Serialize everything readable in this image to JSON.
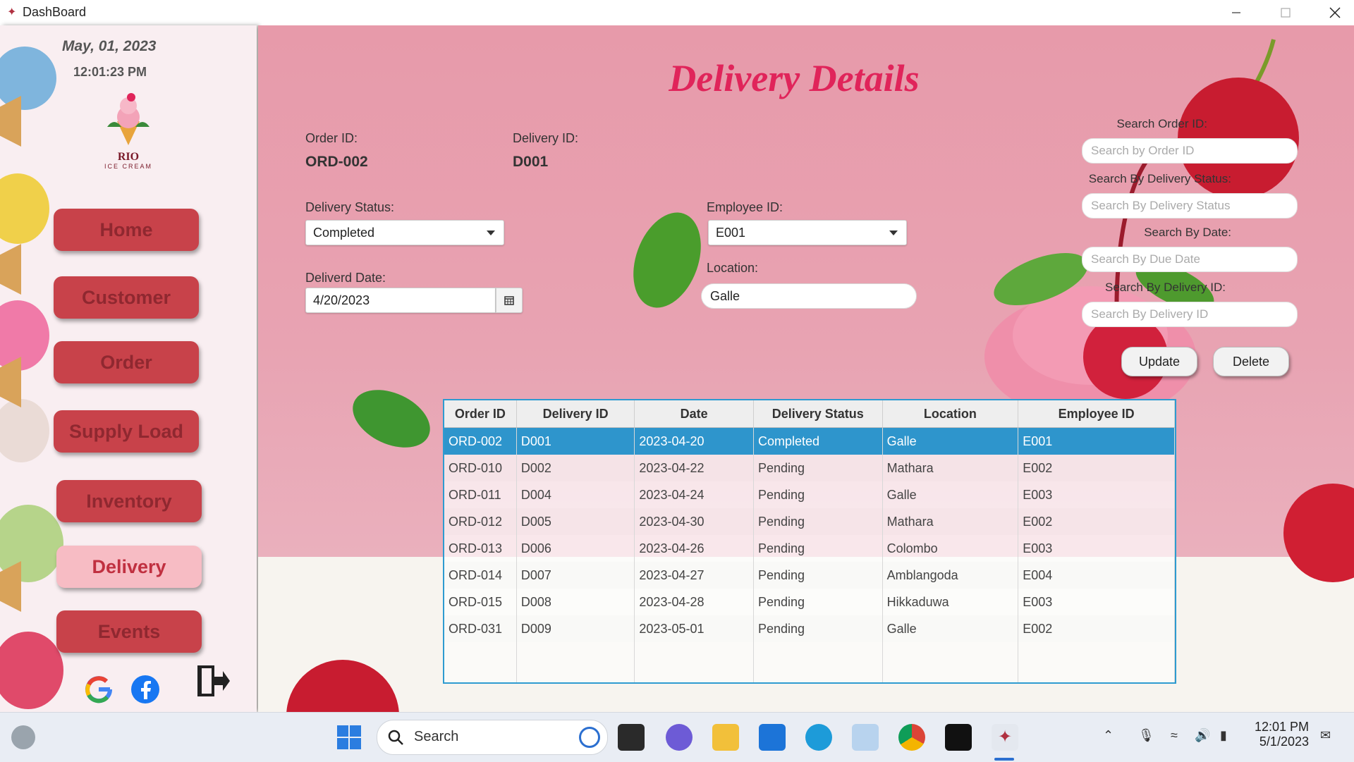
{
  "window": {
    "title": "DashBoard"
  },
  "sidebar": {
    "date": "May,  01, 2023",
    "time": "12:01:23 PM",
    "logo": {
      "name": "RIO",
      "tagline": "ICE CREAM"
    },
    "nav": [
      {
        "label": "Home",
        "active": false
      },
      {
        "label": "Customer",
        "active": false
      },
      {
        "label": "Order",
        "active": false
      },
      {
        "label": "Supply Load",
        "active": false
      },
      {
        "label": "Inventory",
        "active": false
      },
      {
        "label": "Delivery",
        "active": true
      },
      {
        "label": "Events",
        "active": false
      }
    ],
    "social": [
      "google-icon",
      "facebook-icon",
      "logout-icon"
    ]
  },
  "main": {
    "title": "Delivery Details",
    "order_id": {
      "label": "Order ID:",
      "value": "ORD-002"
    },
    "delivery_id": {
      "label": "Delivery ID:",
      "value": "D001"
    },
    "delivery_status": {
      "label": "Delivery Status:",
      "value": "Completed"
    },
    "delivered_date": {
      "label": "Deliverd Date:",
      "value": "4/20/2023"
    },
    "employee_id": {
      "label": "Employee ID:",
      "value": "E001"
    },
    "location": {
      "label": "Location:",
      "value": "Galle"
    },
    "search": {
      "order_id": {
        "label": "Search Order ID:",
        "placeholder": "Search by Order ID"
      },
      "delivery_status": {
        "label": "Search By Delivery Status:",
        "placeholder": "Search By Delivery Status"
      },
      "date": {
        "label": "Search By Date:",
        "placeholder": "Search By Due Date"
      },
      "delivery_id": {
        "label": "Search By Delivery ID:",
        "placeholder": "Search By Delivery ID"
      }
    },
    "buttons": {
      "update": "Update",
      "delete": "Delete"
    },
    "table": {
      "columns": [
        "Order ID",
        "Delivery ID",
        "Date",
        "Delivery Status",
        "Location",
        "Employee ID"
      ],
      "rows": [
        [
          "ORD-002",
          "D001",
          "2023-04-20",
          "Completed",
          "Galle",
          "E001"
        ],
        [
          "ORD-010",
          "D002",
          "2023-04-22",
          "Pending",
          "Mathara",
          "E002"
        ],
        [
          "ORD-011",
          "D004",
          "2023-04-24",
          "Pending",
          "Galle",
          "E003"
        ],
        [
          "ORD-012",
          "D005",
          "2023-04-30",
          "Pending",
          "Mathara",
          "E002"
        ],
        [
          "ORD-013",
          "D006",
          "2023-04-26",
          "Pending",
          "Colombo",
          "E003"
        ],
        [
          "ORD-014",
          "D007",
          "2023-04-27",
          "Pending",
          "Amblangoda",
          "E004"
        ],
        [
          "ORD-015",
          "D008",
          "2023-04-28",
          "Pending",
          "Hikkaduwa",
          "E003"
        ],
        [
          "ORD-031",
          "D009",
          "2023-05-01",
          "Pending",
          "Galle",
          "E002"
        ]
      ],
      "selected_row": 0
    }
  },
  "taskbar": {
    "search_label": "Search",
    "clock_time": "12:01 PM",
    "clock_date": "5/1/2023"
  },
  "colors": {
    "title": "#e0245a",
    "nav": "#c8424a",
    "nav_active": "#f7bcc4",
    "selection": "#2e95cc"
  }
}
